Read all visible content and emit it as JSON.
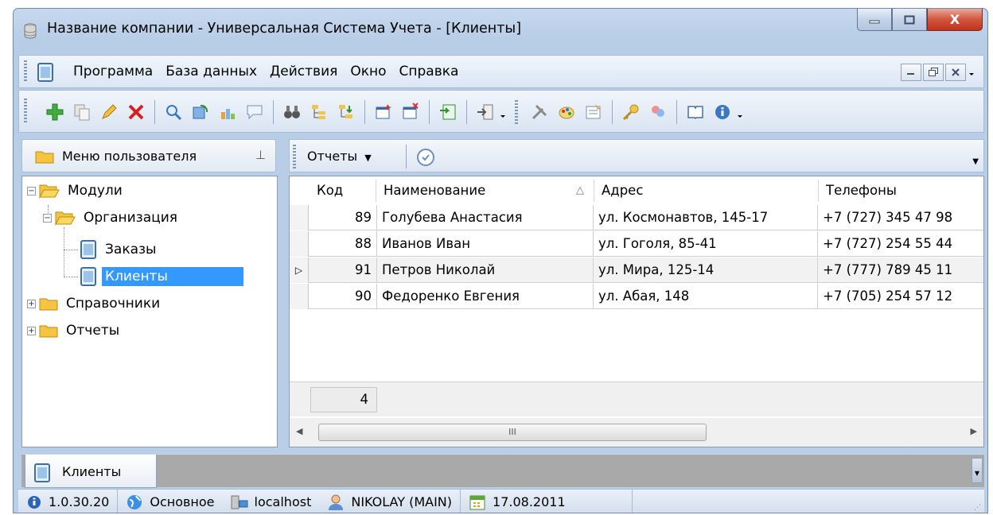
{
  "window": {
    "title": "Название компании - Универсальная Система Учета - [Клиенты]",
    "caption_buttons": [
      "minimize-icon",
      "maximize-icon",
      "close-icon"
    ],
    "close_glyph": "X"
  },
  "menu": {
    "items": [
      "Программа",
      "База данных",
      "Действия",
      "Окно",
      "Справка"
    ]
  },
  "toolbar": {
    "icons": [
      "add-icon",
      "copy-icon",
      "edit-icon",
      "delete-icon",
      "search-icon",
      "refresh-icon",
      "import-icon",
      "comment-icon",
      "binoculars-icon",
      "tree-expand-icon",
      "tree-collapse-icon",
      "new-window-icon",
      "close-window-icon",
      "export-excel-icon",
      "exit-icon",
      "tools-icon",
      "palette-icon",
      "properties-icon",
      "key-icon",
      "users-icon",
      "book-icon",
      "info-icon"
    ]
  },
  "left_panel": {
    "title": "Меню пользователя",
    "pin_glyph": "⊥",
    "tree": [
      {
        "label": "Модули",
        "expander": "−"
      },
      {
        "label": "Организация",
        "expander": "−"
      },
      {
        "label": "Заказы"
      },
      {
        "label": "Клиенты",
        "selected": true
      },
      {
        "label": "Справочники",
        "expander": "+"
      },
      {
        "label": "Отчеты",
        "expander": "+"
      }
    ]
  },
  "grid_toolbar": {
    "reports_label": "Отчеты",
    "reports_arrow": "▼",
    "dropdown_arrow": "▼"
  },
  "grid": {
    "columns": [
      "Код",
      "Наименование",
      "Адрес",
      "Телефоны"
    ],
    "sort_glyph": "△",
    "current_row_glyph": "▷",
    "rows": [
      {
        "code": "89",
        "name": "Голубева Анастасия",
        "address": "ул. Космонавтов, 145-17",
        "phone": "+7 (727) 345 47 98"
      },
      {
        "code": "88",
        "name": "Иванов Иван",
        "address": "ул. Гоголя, 85-41",
        "phone": "+7 (727) 254 55 44"
      },
      {
        "code": "91",
        "name": "Петров Николай",
        "address": "ул. Мира, 125-14",
        "phone": "+7 (777) 789 45 11"
      },
      {
        "code": "90",
        "name": "Федоренко Евгения",
        "address": "ул. Абая, 148",
        "phone": "+7 (705) 254 57 12"
      }
    ],
    "count": "4",
    "scroll_left": "◀",
    "scroll_right": "▶",
    "scroll_thumb": "III"
  },
  "tabs": [
    {
      "label": "Клиенты"
    }
  ],
  "statusbar": {
    "version": "1.0.30.20",
    "database": "Основное",
    "host": "localhost",
    "user": "NIKOLAY (MAIN)",
    "date": "17.08.2011"
  },
  "colors": {
    "selection": "#3399ff",
    "window_frame": "#b9cfe7",
    "close_button": "#c0321c"
  }
}
